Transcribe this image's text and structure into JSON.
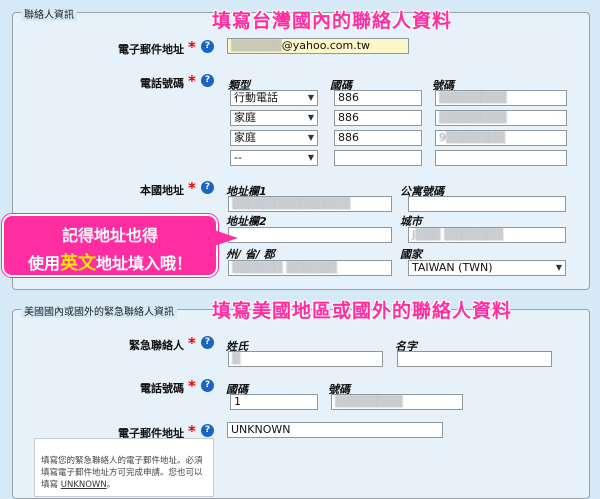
{
  "contact_section": {
    "legend": "聯絡人資訊",
    "overlay_title": "填寫台灣國內的聯絡人資料",
    "email_label": "電子郵件地址",
    "email_value": "▒▒▒▒▒▒@yahoo.com.tw",
    "phone_label": "電話號碼",
    "phone_headers": {
      "type": "類型",
      "country": "國碼",
      "number": "號碼"
    },
    "phone_rows": [
      {
        "type": "行動電話",
        "country": "886",
        "number": "▒▒▒▒▒▒▒▒"
      },
      {
        "type": "家庭",
        "country": "886",
        "number": "▒▒▒▒▒▒▒▒"
      },
      {
        "type": "家庭",
        "country": "886",
        "number": "9▒▒▒▒▒▒▒"
      },
      {
        "type": "--",
        "country": "",
        "number": ""
      }
    ],
    "address_label": "本國地址",
    "address_headers": {
      "line1": "地址欄1",
      "apt": "公寓號碼",
      "line2": "地址欄2",
      "city": "城市",
      "state": "州/ 省/ 郡",
      "country": "國家"
    },
    "address_values": {
      "line1": "▒▒▒▒▒▒▒▒▒▒▒▒▒▒",
      "apt": "",
      "line2": "",
      "city": "J▒▒▒ ▒▒▒▒▒▒▒",
      "state": "▒▒▒▒▒▒ ▒▒▒▒▒▒",
      "country": "TAIWAN (TWN)"
    },
    "callout_line1": "記得地址也得",
    "callout_line2_pre": "使用",
    "callout_line2_hl": "英文",
    "callout_line2_post": "地址填入哦！"
  },
  "emergency_section": {
    "legend": "美國國內或國外的緊急聯絡人資訊",
    "overlay_title": "填寫美國地區或國外的聯絡人資料",
    "contact_label": "緊急聯絡人",
    "name_headers": {
      "last": "姓氏",
      "first": "名字"
    },
    "name_values": {
      "last": "▒",
      "first": ""
    },
    "phone_label": "電話號碼",
    "phone_headers": {
      "country": "國碼",
      "number": "號碼"
    },
    "phone_values": {
      "country": "1",
      "number": "▒▒▒▒▒▒▒▒"
    },
    "email_label": "電子郵件地址",
    "email_value": "UNKNOWN",
    "note_text": "填寫您的緊急聯絡人的電子郵件地址。必須填寫電子郵件地址方可完成申請。您也可以填寫",
    "note_link": "UNKNOWN",
    "note_end": "。"
  },
  "required_mark": "*",
  "help_glyph": "?"
}
